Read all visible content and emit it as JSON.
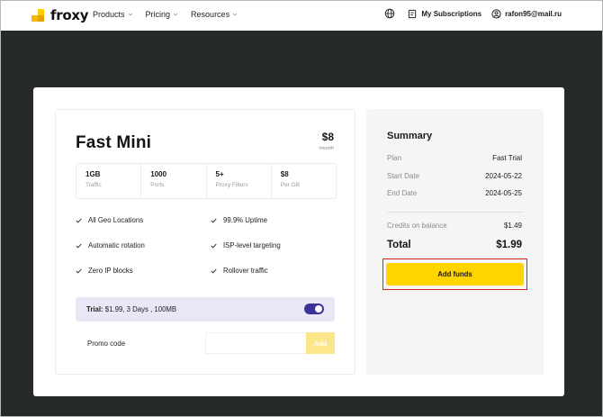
{
  "header": {
    "brand": "froxy",
    "nav": [
      {
        "label": "Products"
      },
      {
        "label": "Pricing"
      },
      {
        "label": "Resources"
      }
    ],
    "subscriptions_label": "My Subscriptions",
    "account_email": "rafon95@mail.ru"
  },
  "plan": {
    "name": "Fast Mini",
    "price": "$8",
    "price_unit": "/month",
    "stats": [
      {
        "value": "1GB",
        "label": "Traffic"
      },
      {
        "value": "1000",
        "label": "Ports"
      },
      {
        "value": "5+",
        "label": "Proxy Filters"
      },
      {
        "value": "$8",
        "label": "Per GB"
      }
    ],
    "features": [
      "All Geo Locations",
      "99.9% Uptime",
      "Automatic rotation",
      "ISP-level targeting",
      "Zero IP blocks",
      "Rollover traffic"
    ],
    "trial_label": "Trial:",
    "trial_details": " $1.99, 3 Days , 100MB",
    "trial_enabled": true,
    "promo_label": "Promo code",
    "promo_value": "",
    "promo_button": "Add"
  },
  "summary": {
    "title": "Summary",
    "rows": [
      {
        "key": "Plan",
        "value": "Fast Trial"
      },
      {
        "key": "Start Date",
        "value": "2024-05-22"
      },
      {
        "key": "End Date",
        "value": "2024-05-25"
      }
    ],
    "credits_label": "Credits on balance",
    "credits_value": "$1.49",
    "total_label": "Total",
    "total_value": "$1.99",
    "add_funds_label": "Add funds"
  },
  "colors": {
    "accent": "#ffd400",
    "toggle": "#3b3399",
    "trial_bg": "#e9e7f6",
    "highlight": "#d9231f",
    "page_bg": "#262a2b"
  }
}
